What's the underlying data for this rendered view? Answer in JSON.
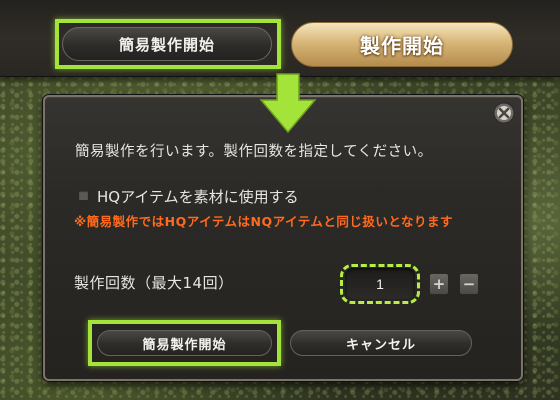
{
  "top_bar": {
    "quick_synthesis_button": "簡易製作開始",
    "synthesize_button": "製作開始"
  },
  "dialog": {
    "instruction": "簡易製作を行います。製作回数を指定してください。",
    "hq_checkbox": {
      "label": "HQアイテムを素材に使用する",
      "checked": false
    },
    "warning": "※簡易製作ではHQアイテムはNQアイテムと同じ扱いとなります",
    "quantity": {
      "label": "製作回数（最大14回）",
      "value": "1",
      "increment": "+",
      "decrement": "−"
    },
    "buttons": {
      "quick_synthesis": "簡易製作開始",
      "cancel": "キャンセル"
    }
  },
  "icons": {
    "close": "close-icon",
    "guide_arrow": "arrow-down-icon"
  },
  "colors": {
    "highlight": "#a4e33a",
    "warning_text": "#ff6a1e",
    "primary_button": "#d8b678"
  }
}
